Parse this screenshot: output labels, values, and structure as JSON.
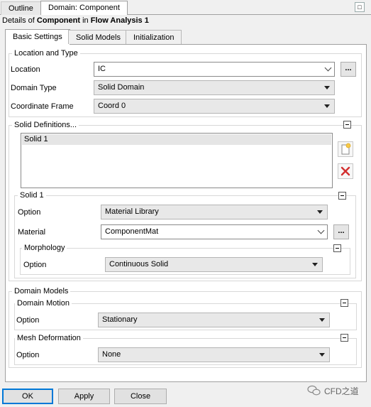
{
  "tabs": [
    {
      "label": "Outline"
    },
    {
      "label": "Domain: Component"
    }
  ],
  "details": {
    "prefix": "Details of ",
    "object": "Component",
    "middle": " in ",
    "analysis": "Flow Analysis 1"
  },
  "inner_tabs": [
    {
      "label": "Basic Settings"
    },
    {
      "label": "Solid Models"
    },
    {
      "label": "Initialization"
    }
  ],
  "location_type": {
    "title": "Location and Type",
    "location_label": "Location",
    "location_value": "IC",
    "browse_label": "...",
    "domain_type_label": "Domain Type",
    "domain_type_value": "Solid Domain",
    "coord_label": "Coordinate Frame",
    "coord_value": "Coord 0"
  },
  "solid_definitions": {
    "title": "Solid Definitions...",
    "items": [
      "Solid 1"
    ]
  },
  "solid1": {
    "title": "Solid 1",
    "option_label": "Option",
    "option_value": "Material Library",
    "material_label": "Material",
    "material_value": "ComponentMat",
    "browse_label": "...",
    "morphology": {
      "title": "Morphology",
      "option_label": "Option",
      "option_value": "Continuous Solid"
    }
  },
  "domain_models": {
    "title": "Domain Models",
    "motion": {
      "title": "Domain Motion",
      "option_label": "Option",
      "option_value": "Stationary"
    },
    "mesh": {
      "title": "Mesh Deformation",
      "option_label": "Option",
      "option_value": "None"
    }
  },
  "buttons": {
    "ok": "OK",
    "apply": "Apply",
    "close": "Close"
  },
  "watermark": "CFD之道",
  "colors": {
    "accent": "#0078d7",
    "delete": "#d32f2f"
  }
}
